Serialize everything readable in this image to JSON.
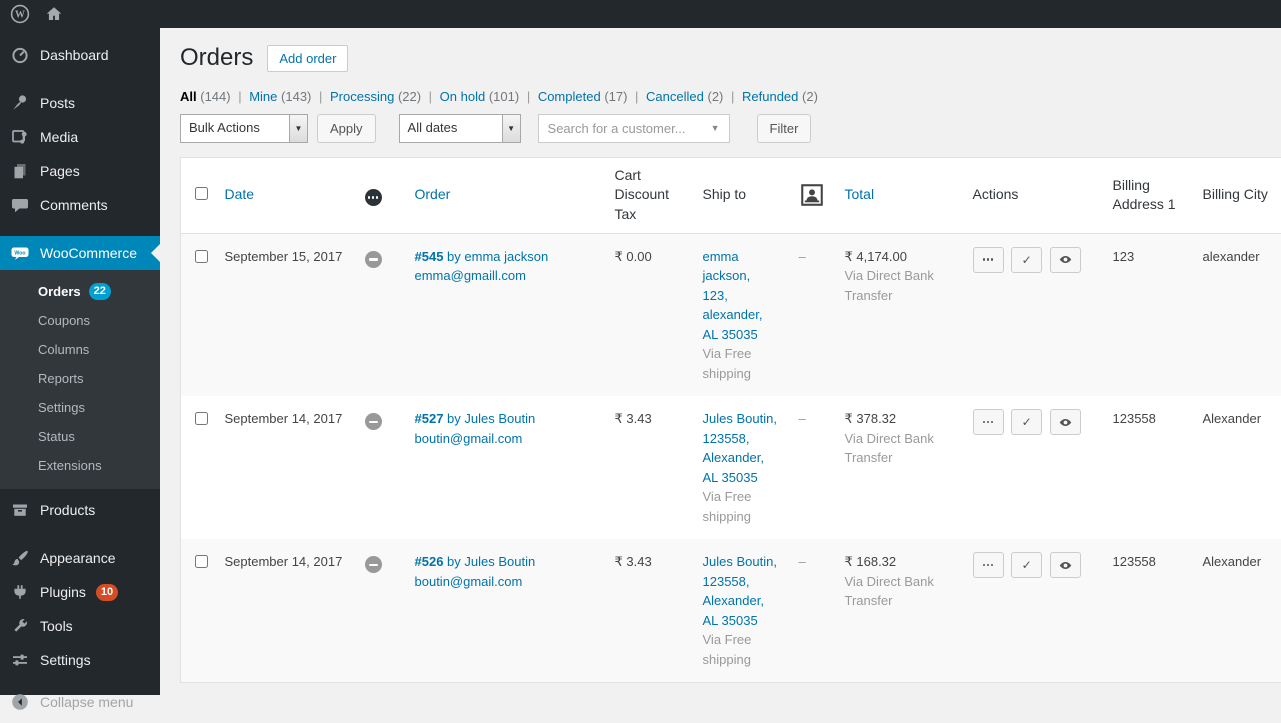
{
  "colors": {
    "admin_dark": "#23282d",
    "submenu_dark": "#32373c",
    "active_menu_blue": "#0087ba",
    "link_blue": "#0073aa",
    "orders_badge_blue": "#00a0d2",
    "plugins_badge_red": "#d54e21",
    "page_bg": "#f1f1f1"
  },
  "admin_bar": {
    "icons": [
      "wordpress-logo",
      "home"
    ]
  },
  "sidebar": {
    "items": [
      {
        "label": "Dashboard",
        "icon": "dashboard-gauge-icon"
      },
      {
        "label": "Posts",
        "icon": "pushpin-icon"
      },
      {
        "label": "Media",
        "icon": "media-icon"
      },
      {
        "label": "Pages",
        "icon": "pages-icon"
      },
      {
        "label": "Comments",
        "icon": "comment-bubble-icon"
      },
      {
        "label": "WooCommerce",
        "icon": "woocommerce-bubble-icon",
        "active": true
      }
    ],
    "submenu": {
      "items": [
        {
          "label": "Orders",
          "badge": "22",
          "current": true
        },
        {
          "label": "Coupons"
        },
        {
          "label": "Columns"
        },
        {
          "label": "Reports"
        },
        {
          "label": "Settings"
        },
        {
          "label": "Status"
        },
        {
          "label": "Extensions"
        }
      ]
    },
    "items_lower": [
      {
        "label": "Products",
        "icon": "products-box-icon"
      },
      {
        "label": "Appearance",
        "icon": "paintbrush-icon"
      },
      {
        "label": "Plugins",
        "icon": "plug-icon",
        "badge": "10"
      },
      {
        "label": "Tools",
        "icon": "wrench-icon"
      },
      {
        "label": "Settings",
        "icon": "sliders-icon"
      },
      {
        "label": "Collapse menu",
        "icon": "collapse-arrow-icon"
      }
    ]
  },
  "main": {
    "title": "Orders",
    "add_order_label": "Add order",
    "status_filters": [
      {
        "label": "All",
        "count": "(144)",
        "current": true
      },
      {
        "label": "Mine",
        "count": "(143)"
      },
      {
        "label": "Processing",
        "count": "(22)"
      },
      {
        "label": "On hold",
        "count": "(101)"
      },
      {
        "label": "Completed",
        "count": "(17)"
      },
      {
        "label": "Cancelled",
        "count": "(2)"
      },
      {
        "label": "Refunded",
        "count": "(2)"
      }
    ],
    "toolbar": {
      "bulk_actions_label": "Bulk Actions",
      "apply_label": "Apply",
      "all_dates_label": "All dates",
      "search_placeholder": "Search for a customer...",
      "filter_label": "Filter"
    },
    "table": {
      "headers": {
        "date": "Date",
        "order": "Order",
        "cart_discount_tax": "Cart Discount Tax",
        "ship_to": "Ship to",
        "total": "Total",
        "actions": "Actions",
        "billing_address_1": "Billing Address 1",
        "billing_city": "Billing City"
      },
      "rows": [
        {
          "date": "September 15, 2017",
          "status": "on-hold",
          "order_number": "#545",
          "order_by": "by emma jackson",
          "email": "emma@gmaill.com",
          "cart_discount_tax": "₹ 0.00",
          "ship_to": "emma jackson, 123, alexander, AL 35035",
          "ship_via": "Via Free shipping",
          "customer": "–",
          "total": "₹ 4,174.00",
          "total_via": "Via Direct Bank Transfer",
          "billing_address_1": "123",
          "billing_city": "alexander"
        },
        {
          "date": "September 14, 2017",
          "status": "on-hold",
          "order_number": "#527",
          "order_by": "by Jules Boutin",
          "email": "boutin@gmail.com",
          "cart_discount_tax": "₹ 3.43",
          "ship_to": "Jules Boutin, 123558, Alexander, AL 35035",
          "ship_via": "Via Free shipping",
          "customer": "–",
          "total": "₹ 378.32",
          "total_via": "Via Direct Bank Transfer",
          "billing_address_1": "123558",
          "billing_city": "Alexander"
        },
        {
          "date": "September 14, 2017",
          "status": "on-hold",
          "order_number": "#526",
          "order_by": "by Jules Boutin",
          "email": "boutin@gmail.com",
          "cart_discount_tax": "₹ 3.43",
          "ship_to": "Jules Boutin, 123558, Alexander, AL 35035",
          "ship_via": "Via Free shipping",
          "customer": "–",
          "total": "₹ 168.32",
          "total_via": "Via Direct Bank Transfer",
          "billing_address_1": "123558",
          "billing_city": "Alexander"
        }
      ],
      "row_action_icons": [
        "ellipsis-actions-icon",
        "complete-check-icon",
        "view-eye-icon"
      ]
    }
  }
}
